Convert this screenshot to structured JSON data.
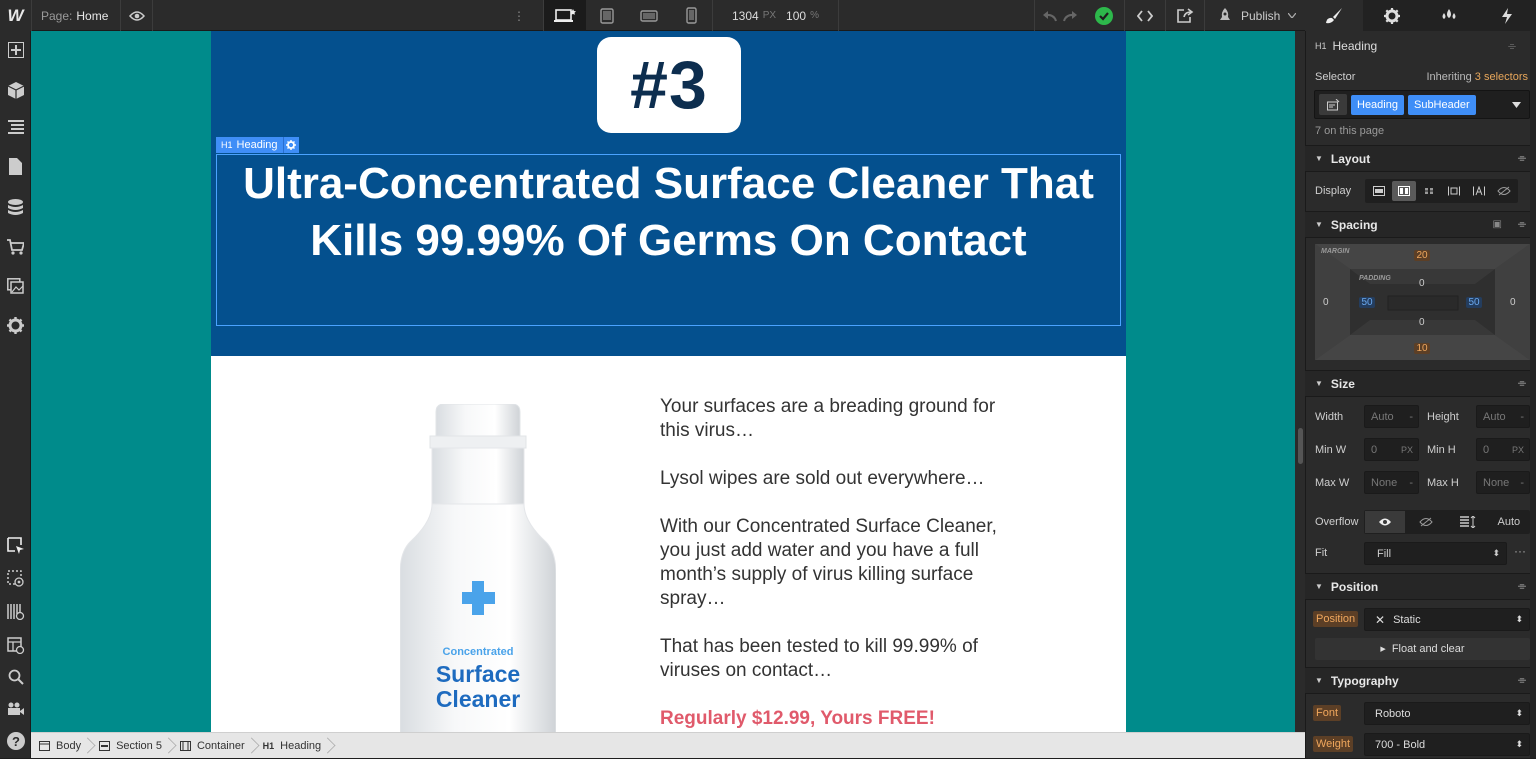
{
  "topbar": {
    "logo": "W",
    "page_label": "Page:",
    "page_name": "Home",
    "width": "1304",
    "width_unit": "PX",
    "zoom": "100",
    "zoom_unit": "%",
    "publish": "Publish"
  },
  "canvas": {
    "badge": "#3",
    "element_label": "Heading",
    "element_tag": "H1",
    "heading": "Ultra-Concentrated Surface Cleaner That Kills 99.99% Of Germs On Contact",
    "paragraphs": [
      "Your surfaces are a breading ground for this virus…",
      "Lysol wipes are sold out everywhere…",
      "With our Concentrated Surface Cleaner, you just add water and you have a full month’s supply of virus killing surface spray…",
      "That has been tested to kill 99.99% of viruses on contact…"
    ],
    "price": "Regularly $12.99, Yours FREE!",
    "bottle_small": "Concentrated",
    "bottle_big1": "Surface",
    "bottle_big2": "Cleaner"
  },
  "breadcrumb": [
    {
      "label": "Body",
      "icon": "body-icon"
    },
    {
      "label": "Section 5",
      "icon": "section-icon"
    },
    {
      "label": "Container",
      "icon": "container-icon"
    },
    {
      "label": "Heading",
      "icon": "h1-icon"
    }
  ],
  "panel": {
    "element_tag": "H1",
    "element_name": "Heading",
    "selector_label": "Selector",
    "inheriting": "Inheriting",
    "inheriting_count": "3 selectors",
    "classes": [
      "Heading",
      "SubHeader"
    ],
    "on_page": "7 on this page",
    "sections": {
      "layout": "Layout",
      "spacing": "Spacing",
      "size": "Size",
      "position": "Position",
      "typography": "Typography"
    },
    "display_label": "Display",
    "spacing": {
      "margin_label": "MARGIN",
      "padding_label": "PADDING",
      "margin_top": "20",
      "margin_right": "0",
      "margin_bottom": "10",
      "margin_left": "0",
      "padding_top": "0",
      "padding_right": "50",
      "padding_bottom": "0",
      "padding_left": "50"
    },
    "size": {
      "width_label": "Width",
      "width_value": "Auto",
      "height_label": "Height",
      "height_value": "Auto",
      "minw_label": "Min W",
      "minw_value": "0",
      "minw_unit": "PX",
      "minh_label": "Min H",
      "minh_value": "0",
      "minh_unit": "PX",
      "maxw_label": "Max W",
      "maxw_value": "None",
      "maxh_label": "Max H",
      "maxh_value": "None",
      "overflow_label": "Overflow",
      "overflow_auto": "Auto",
      "fit_label": "Fit",
      "fit_value": "Fill"
    },
    "position": {
      "label": "Position",
      "value": "Static",
      "float": "Float and clear"
    },
    "typography": {
      "font_label": "Font",
      "font_value": "Roboto",
      "weight_label": "Weight",
      "weight_value": "700 - Bold"
    }
  },
  "colors": {
    "canvas_bg": "#008b8b",
    "hero_blue": "#04508e",
    "accent_blue": "#3f8ef7",
    "price_red": "#e05a6b",
    "publish_green": "#2db84b"
  }
}
